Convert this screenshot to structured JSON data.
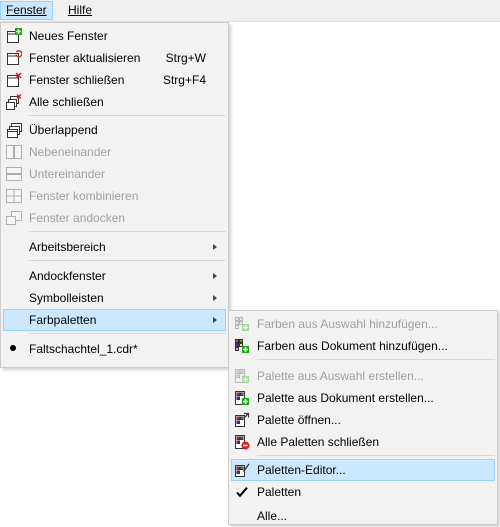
{
  "menubar": {
    "fenster": "Fenster",
    "hilfe": "Hilfe"
  },
  "fenster_menu": {
    "neues_fenster": "Neues Fenster",
    "aktualisieren": "Fenster aktualisieren",
    "aktualisieren_shortcut": "Strg+W",
    "schliessen": "Fenster schließen",
    "schliessen_shortcut": "Strg+F4",
    "alle_schliessen": "Alle schließen",
    "ueberlappend": "Überlappend",
    "nebeneinander": "Nebeneinander",
    "untereinander": "Untereinander",
    "kombinieren": "Fenster kombinieren",
    "andocken": "Fenster andocken",
    "arbeitsbereich": "Arbeitsbereich",
    "andockfenster": "Andockfenster",
    "symbolleisten": "Symbolleisten",
    "farbpaletten": "Farbpaletten",
    "document": "Faltschachtel_1.cdr*"
  },
  "farbpaletten_menu": {
    "farben_auswahl": "Farben aus Auswahl hinzufügen...",
    "farben_dokument": "Farben aus Dokument hinzufügen...",
    "palette_auswahl": "Palette aus Auswahl erstellen...",
    "palette_dokument": "Palette aus Dokument erstellen...",
    "palette_oeffnen": "Palette öffnen...",
    "alle_paletten_schliessen": "Alle Paletten schließen",
    "paletten_editor": "Paletten-Editor...",
    "paletten": "Paletten",
    "partial": "Alle..."
  },
  "colors": {
    "highlight": "#cce8ff",
    "highlight_border": "#99d1ff",
    "icon_green": "#1aa31a",
    "icon_red": "#d42020",
    "menu_bg": "#f2f2f2"
  }
}
